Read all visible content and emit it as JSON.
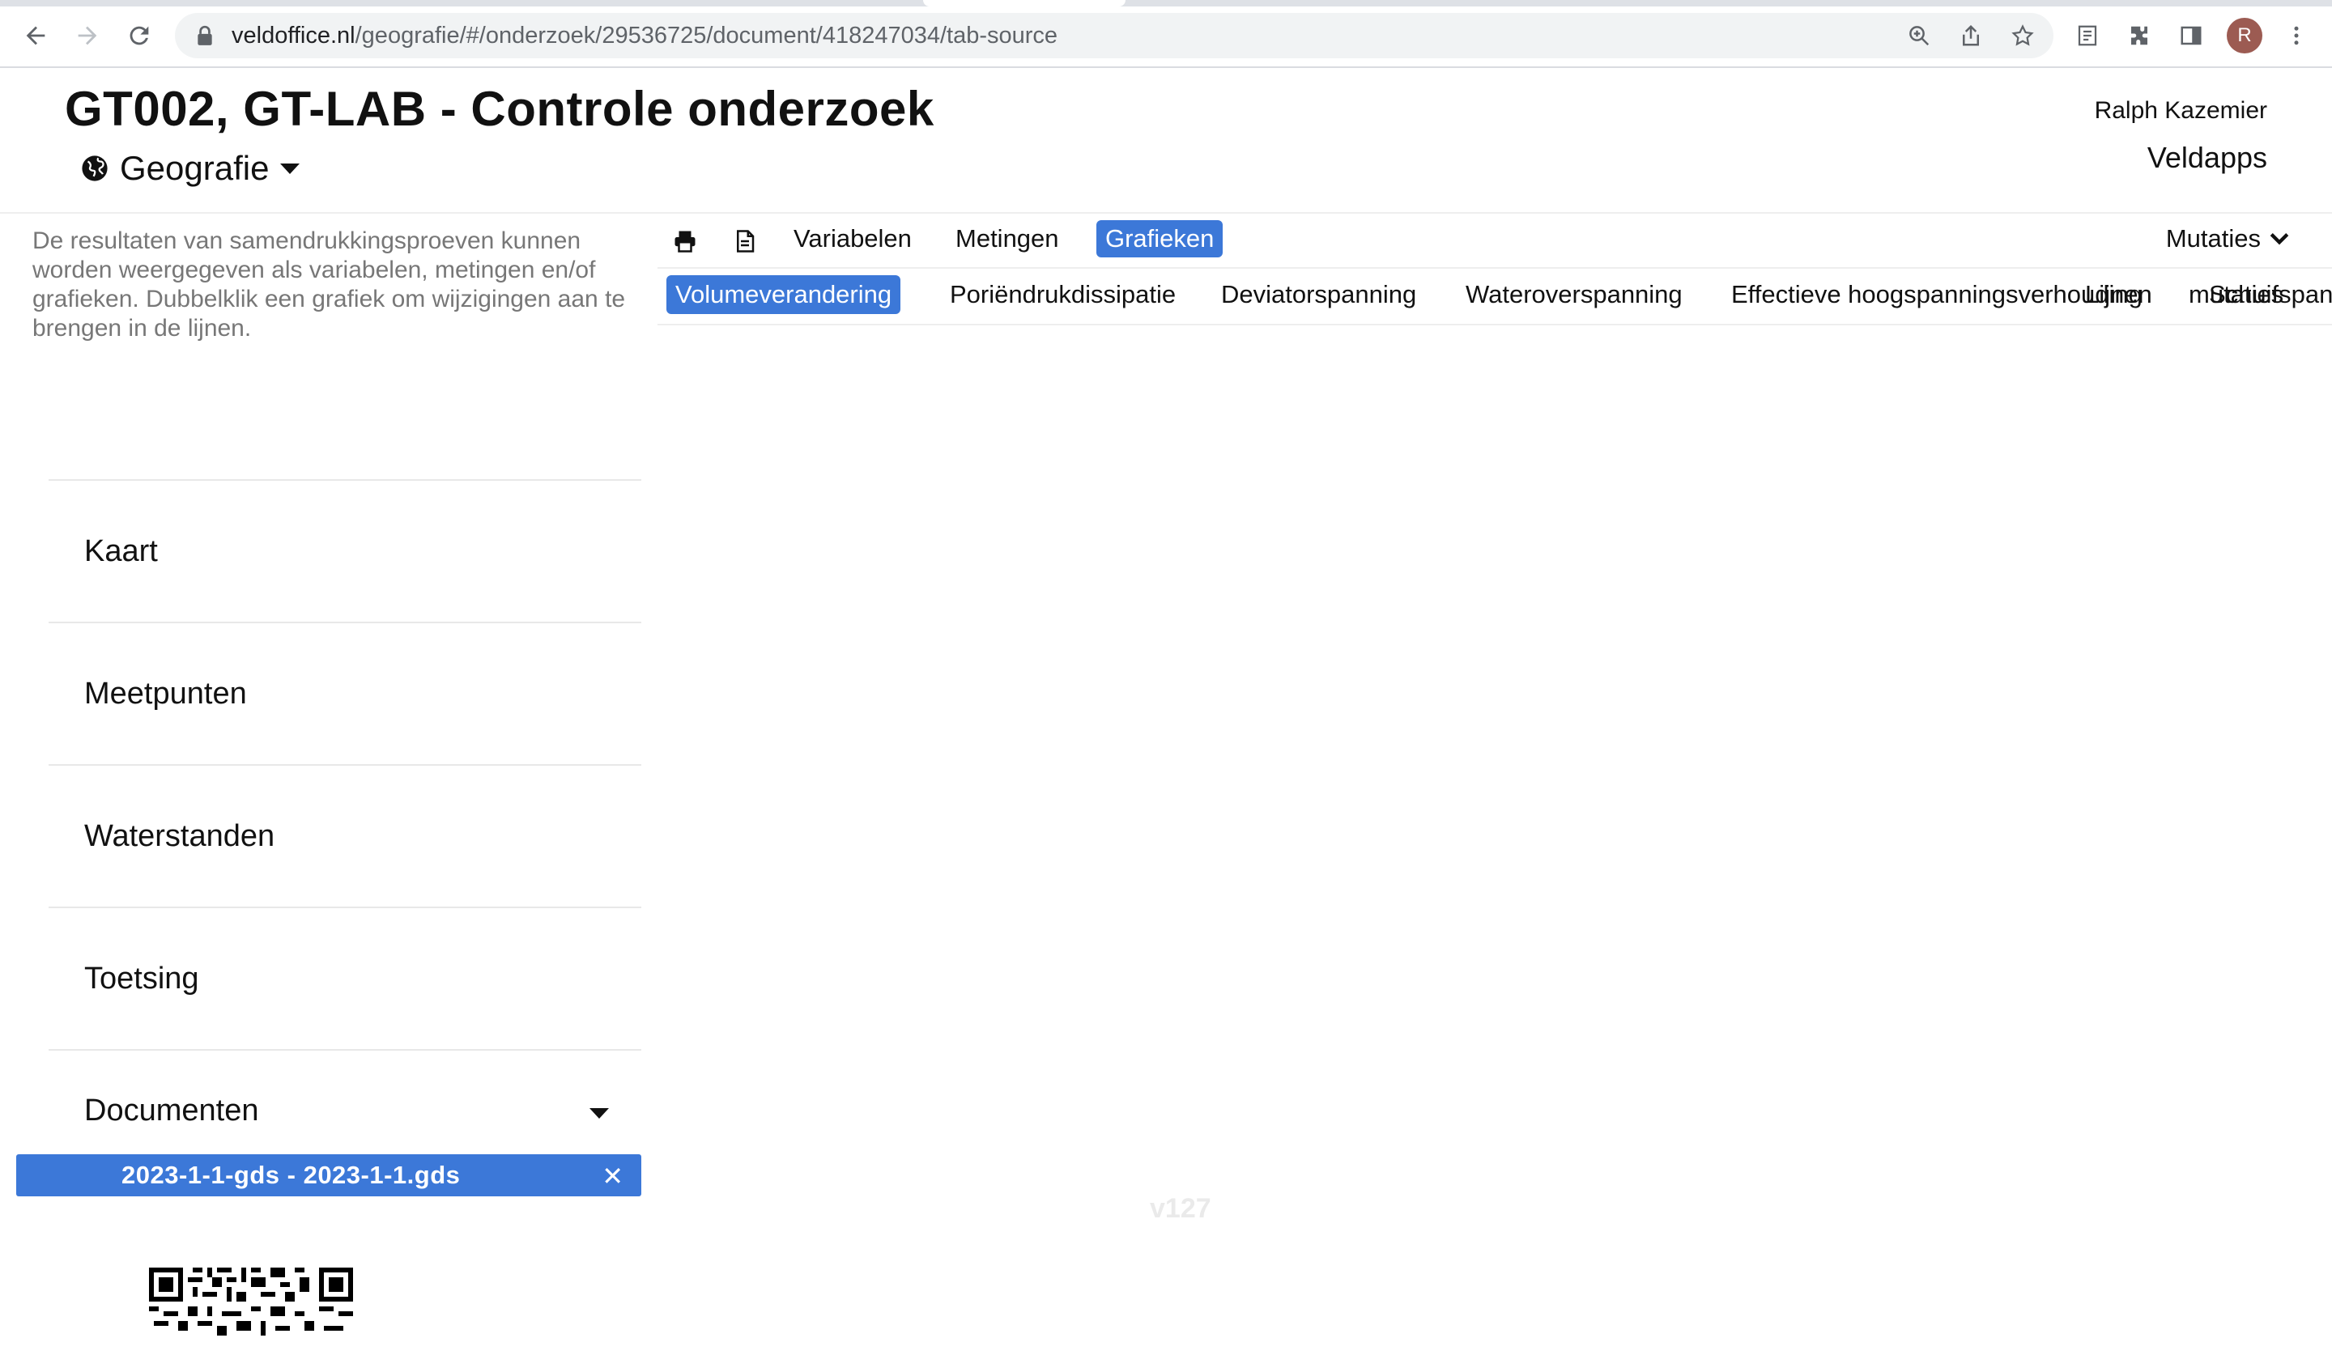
{
  "browser": {
    "url_host": "veldoffice.nl",
    "url_path": "/geografie/#/onderzoek/29536725/document/418247034/tab-source",
    "profile_initial": "R"
  },
  "header": {
    "title": "GT002, GT-LAB - Controle onderzoek",
    "module": "Geografie",
    "user": "Ralph Kazemier",
    "app": "Veldapps"
  },
  "sidebar": {
    "help": "De resultaten van samendrukkingsproeven kunnen worden weergegeven als variabelen, metingen en/of grafieken. Dubbelklik een grafiek om wijzigingen aan te brengen in de lijnen.",
    "menu": [
      "Kaart",
      "Meetpunten",
      "Waterstanden",
      "Toetsing",
      "Documenten"
    ],
    "open_document": "2023-1-1-gds - 2023-1-1.gds",
    "close_glyph": "✕"
  },
  "toolbar": {
    "tabs": [
      "Variabelen",
      "Metingen",
      "Grafieken"
    ],
    "active_tab": "Grafieken",
    "mutaties": "Mutaties"
  },
  "subtabs": {
    "items": [
      "Volumeverandering",
      "Poriëndrukdissipatie",
      "Deviatorspanning",
      "Wateroverspanning",
      "Effectieve hoogspanningsverhouding",
      "Lijnen",
      "mutaties",
      "Schuifspanning"
    ],
    "active": "Volumeverandering"
  },
  "footer": {
    "version": "v127"
  },
  "colors": {
    "accent": "#3c78d8",
    "muted_text": "#777777"
  }
}
